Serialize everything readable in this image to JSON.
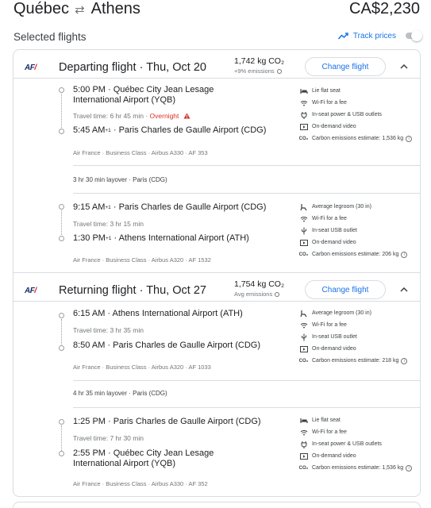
{
  "header": {
    "origin": "Québec",
    "swap_icon": "⇄",
    "destination": "Athens",
    "total_price": "CA$2,230"
  },
  "subheader": {
    "title": "Selected flights",
    "track_label": "Track prices"
  },
  "outbound": {
    "airline_logo": "AF",
    "title": "Departing flight",
    "separator": "·",
    "date": "Thu, Oct 20",
    "emissions": "1,742 kg CO₂",
    "emissions_note": "+9% emissions",
    "change_label": "Change flight",
    "legs": [
      {
        "dep_time": "5:00 PM",
        "dep_airport": "Québec City Jean Lesage International Airport (YQB)",
        "duration": "Travel time: 6 hr 45 min",
        "overnight": "Overnight",
        "arr_time": "5:45 AM",
        "arr_sup": "+1",
        "arr_airport": "Paris Charles de Gaulle Airport (CDG)",
        "details": "Air France · Business Class · Airbus A330 · AF 353",
        "amenities": [
          {
            "icon": "lie-flat-seat-icon",
            "text": "Lie flat seat"
          },
          {
            "icon": "wifi-icon",
            "text": "Wi-Fi for a fee"
          },
          {
            "icon": "power-outlet-icon",
            "text": "In-seat power & USB outlets"
          },
          {
            "icon": "video-icon",
            "text": "On-demand video"
          },
          {
            "icon": "co2-icon",
            "text": "Carbon emissions estimate: 1,536 kg"
          }
        ]
      },
      {
        "dep_time": "9:15 AM",
        "dep_sup": "+1",
        "dep_airport": "Paris Charles de Gaulle Airport (CDG)",
        "duration": "Travel time: 3 hr 15 min",
        "arr_time": "1:30 PM",
        "arr_sup": "+1",
        "arr_airport": "Athens International Airport (ATH)",
        "details": "Air France · Business Class · Airbus A320 · AF 1532",
        "amenities": [
          {
            "icon": "legroom-icon",
            "text": "Average legroom (30 in)"
          },
          {
            "icon": "wifi-icon",
            "text": "Wi-Fi for a fee"
          },
          {
            "icon": "usb-icon",
            "text": "In-seat USB outlet"
          },
          {
            "icon": "video-icon",
            "text": "On-demand video"
          },
          {
            "icon": "co2-icon",
            "text": "Carbon emissions estimate: 206 kg"
          }
        ]
      }
    ],
    "layover": "3 hr 30 min layover · Paris (CDG)"
  },
  "return": {
    "airline_logo": "AF",
    "title": "Returning flight",
    "separator": "·",
    "date": "Thu, Oct 27",
    "emissions": "1,754 kg CO₂",
    "emissions_note": "Avg emissions",
    "change_label": "Change flight",
    "legs": [
      {
        "dep_time": "6:15 AM",
        "dep_airport": "Athens International Airport (ATH)",
        "duration": "Travel time: 3 hr 35 min",
        "arr_time": "8:50 AM",
        "arr_airport": "Paris Charles de Gaulle Airport (CDG)",
        "details": "Air France · Business Class · Airbus A320 · AF 1033",
        "amenities": [
          {
            "icon": "legroom-icon",
            "text": "Average legroom (30 in)"
          },
          {
            "icon": "wifi-icon",
            "text": "Wi-Fi for a fee"
          },
          {
            "icon": "usb-icon",
            "text": "In-seat USB outlet"
          },
          {
            "icon": "video-icon",
            "text": "On-demand video"
          },
          {
            "icon": "co2-icon",
            "text": "Carbon emissions estimate: 218 kg"
          }
        ]
      },
      {
        "dep_time": "1:25 PM",
        "dep_airport": "Paris Charles de Gaulle Airport (CDG)",
        "duration": "Travel time: 7 hr 30 min",
        "arr_time": "2:55 PM",
        "arr_airport": "Québec City Jean Lesage International Airport (YQB)",
        "details": "Air France · Business Class · Airbus A330 · AF 352",
        "amenities": [
          {
            "icon": "lie-flat-seat-icon",
            "text": "Lie flat seat"
          },
          {
            "icon": "wifi-icon",
            "text": "Wi-Fi for a fee"
          },
          {
            "icon": "power-outlet-icon",
            "text": "In-seat power & USB outlets"
          },
          {
            "icon": "video-icon",
            "text": "On-demand video"
          },
          {
            "icon": "co2-icon",
            "text": "Carbon emissions estimate: 1,536 kg"
          }
        ]
      }
    ],
    "layover": "4 hr 35 min layover · Paris (CDG)"
  },
  "colors": {
    "accent": "#1a73e8",
    "warning": "#d93025",
    "border": "#dadce0",
    "muted": "#70757a"
  }
}
